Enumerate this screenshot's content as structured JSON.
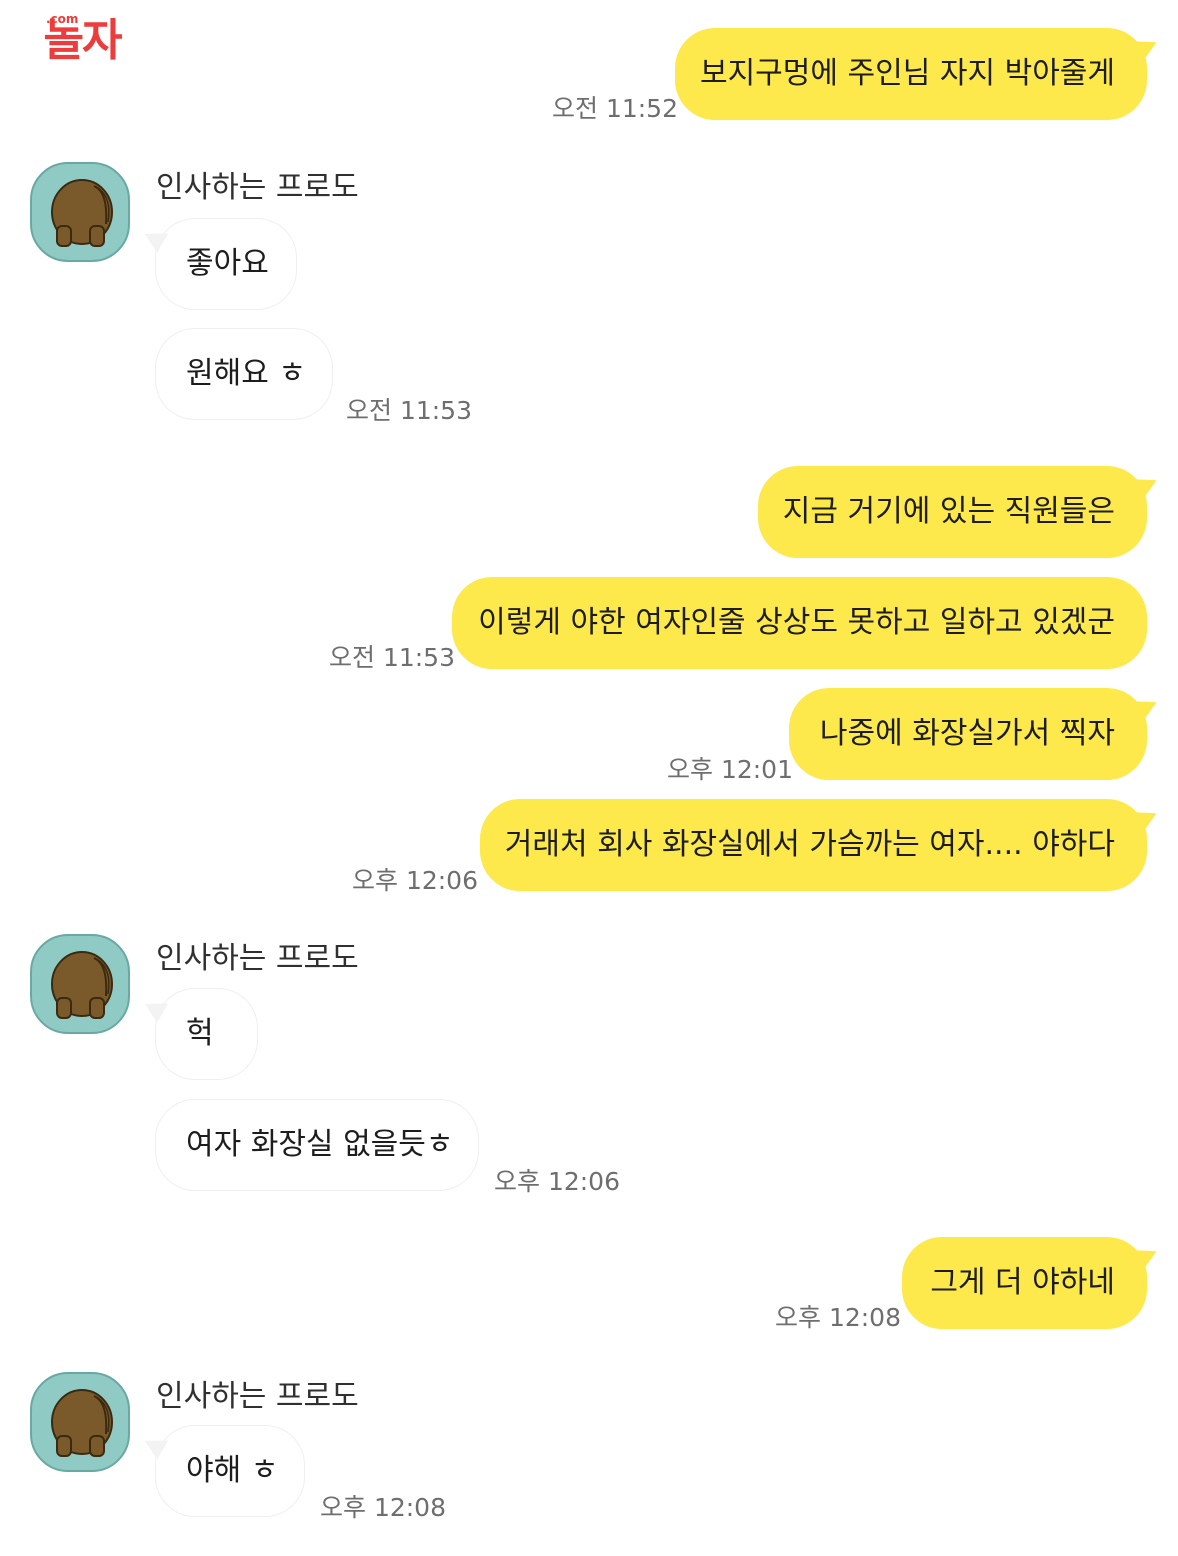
{
  "logo": {
    "text": "놀자",
    "sub": ".com"
  },
  "messages": {
    "m1": {
      "text": "보지구멍에 주인님 자지 박아줄게",
      "time": "오전 11:52"
    },
    "g1": {
      "name": "인사하는 프로도",
      "b1": "좋아요",
      "b2": "원해요 ㅎ",
      "time": "오전 11:53"
    },
    "m2": {
      "text": "지금 거기에 있는 직원들은"
    },
    "m3": {
      "text": "이렇게 야한 여자인줄 상상도 못하고 일하고 있겠군",
      "time": "오전 11:53"
    },
    "m4": {
      "text": "나중에 화장실가서 찍자",
      "time": "오후 12:01"
    },
    "m5": {
      "text": "거래처 회사 화장실에서 가슴까는 여자.... 야하다",
      "time": "오후 12:06"
    },
    "g2": {
      "name": "인사하는 프로도",
      "b1": "헉",
      "b2": "여자 화장실 없을듯ㅎ",
      "time": "오후 12:06"
    },
    "m6": {
      "text": "그게 더 야하네",
      "time": "오후 12:08"
    },
    "g3": {
      "name": "인사하는 프로도",
      "b1": "야해 ㅎ",
      "time": "오후 12:08"
    }
  },
  "colors": {
    "outgoing_bubble": "#fde94b",
    "avatar_bg": "#8fcac5",
    "bear": "#7a5a2a"
  },
  "icons": {
    "avatar": "bear-back-icon"
  }
}
